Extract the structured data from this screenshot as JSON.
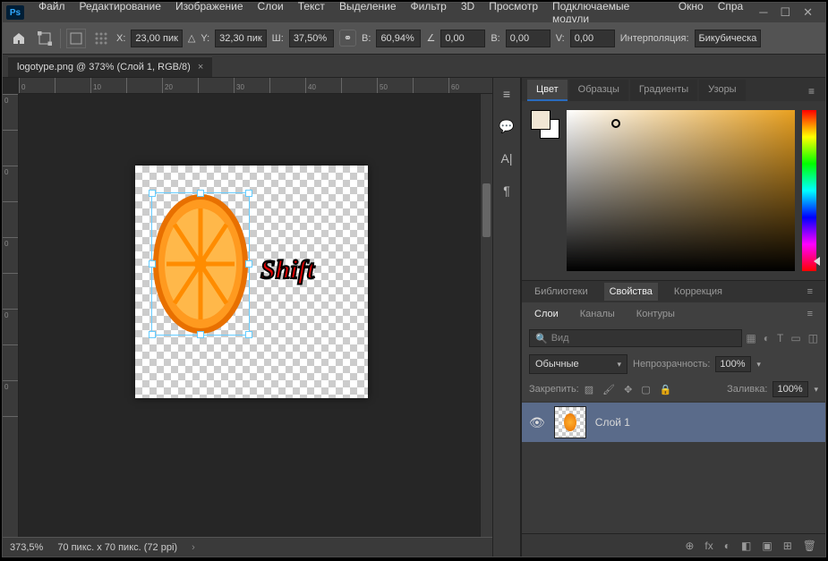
{
  "app_logo": "Ps",
  "menu": [
    "Файл",
    "Редактирование",
    "Изображение",
    "Слои",
    "Текст",
    "Выделение",
    "Фильтр",
    "3D",
    "Просмотр",
    "Подключаемые модули",
    "Окно",
    "Спра"
  ],
  "options": {
    "x_label": "X:",
    "x": "23,00 пик",
    "y_label": "Y:",
    "y": "32,30 пик",
    "w_label": "Ш:",
    "w": "37,50%",
    "h_label": "В:",
    "h": "60,94%",
    "angle_label": "",
    "angle": "0,00",
    "skewh_label": "В:",
    "skewh": "0,00",
    "skewv_label": "V:",
    "skewv": "0,00",
    "interp_label": "Интерполяция:",
    "interp": "Бикубическа"
  },
  "tab": {
    "title": "logotype.png @ 373% (Слой 1, RGB/8)"
  },
  "ruler_h": [
    "0",
    "",
    "10",
    "",
    "20",
    "",
    "30",
    "",
    "40",
    "",
    "50",
    "",
    "60"
  ],
  "ruler_v": [
    "0",
    "",
    "0",
    "",
    "0",
    "",
    "0",
    "",
    "0",
    "",
    "0"
  ],
  "annotation": "Shift",
  "status": {
    "zoom": "373,5%",
    "info": "70 пикс. x 70 пикс. (72 ppi)"
  },
  "color_tabs": [
    "Цвет",
    "Образцы",
    "Градиенты",
    "Узоры"
  ],
  "mid_tabs": [
    "Библиотеки",
    "Свойства",
    "Коррекция"
  ],
  "layer_tabs": [
    "Слои",
    "Каналы",
    "Контуры"
  ],
  "layer_search_placeholder": "Вид",
  "blend": {
    "mode": "Обычные",
    "opacity_label": "Непрозрачность:",
    "opacity": "100%"
  },
  "lock": {
    "label": "Закрепить:",
    "fill_label": "Заливка:",
    "fill": "100%"
  },
  "layer": {
    "name": "Слой 1"
  },
  "footer_icons": [
    "⊕",
    "fx",
    "◐",
    "◧",
    "▣",
    "⊞",
    "🗑"
  ]
}
